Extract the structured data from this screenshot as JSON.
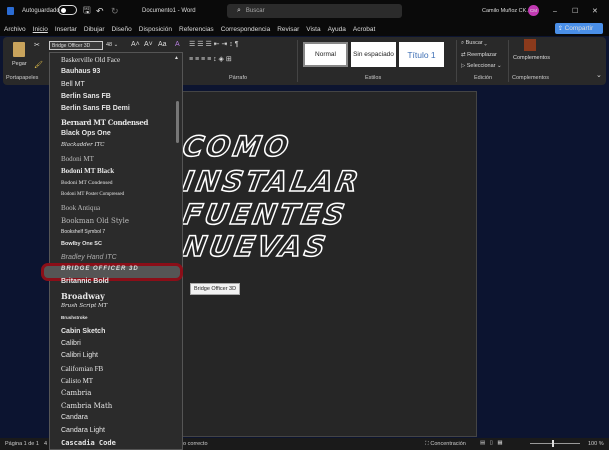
{
  "titlebar": {
    "autosave": "Autoguardado",
    "doc_title": "Documento1 - Word",
    "search_placeholder": "Buscar",
    "user": "Camilo Muñoz CK.",
    "initials": "CM"
  },
  "menu": [
    "Archivo",
    "Inicio",
    "Insertar",
    "Dibujar",
    "Diseño",
    "Disposición",
    "Referencias",
    "Correspondencia",
    "Revisar",
    "Vista",
    "Ayuda",
    "Acrobat"
  ],
  "share": "Compartir",
  "ribbon": {
    "paste": "Pegar",
    "font_name": "Bridge Officer 3D",
    "font_size": "48",
    "groups": {
      "clipboard": "Portapapeles",
      "paragraph": "Párrafo",
      "styles": "Estilos",
      "editing": "Edición",
      "addins": "Complementos"
    },
    "styles": [
      "Normal",
      "Sin espaciado",
      "Título 1"
    ],
    "editing": [
      "Buscar",
      "Reemplazar",
      "Seleccionar"
    ],
    "addins_button": "Complementos"
  },
  "fonts": [
    "Baskerville Old Face",
    "Bauhaus 93",
    "Bell MT",
    "Berlin Sans FB",
    "Berlin Sans FB Demi",
    "Bernard MT Condensed",
    "Black Ops One",
    "Blackadder ITC",
    "Bodoni MT",
    "Bodoni MT Black",
    "Bodoni MT Condensed",
    "Bodoni MT Poster Compressed",
    "Book Antiqua",
    "Bookman Old Style",
    "Bookshelf Symbol 7",
    "Bowlby One SC",
    "Bradley Hand ITC",
    "Bridge Officer 3D",
    "Britannic Bold",
    "Broadway",
    "Brush Script MT",
    "Brushstroke",
    "Cabin Sketch",
    "Calibri",
    "Calibri Light",
    "Californian FB",
    "Calisto MT",
    "Cambria",
    "Cambria Math",
    "Candara",
    "Candara Light",
    "Cascadia Code"
  ],
  "tooltip": "Bridge Officer 3D",
  "document": [
    "COMO",
    "INSTALAR",
    "FUENTES",
    "NUEVAS"
  ],
  "status": {
    "page": "Página 1 de 1",
    "words": "4",
    "proofing": "do correcto",
    "focus": "Concentración",
    "zoom": "100 %"
  }
}
